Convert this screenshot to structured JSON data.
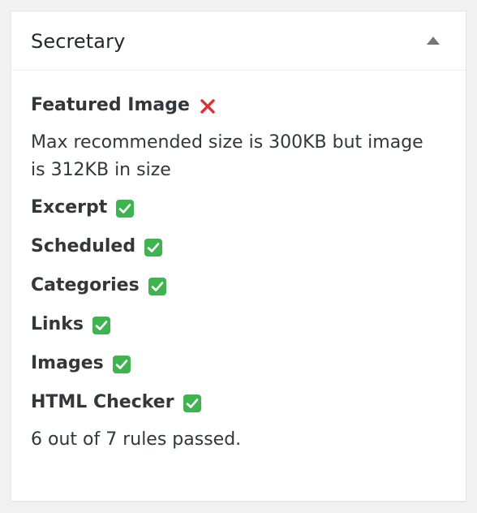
{
  "panel": {
    "title": "Secretary",
    "toggle_icon": "triangle-up-icon"
  },
  "rules": [
    {
      "name": "Featured Image",
      "status": "fail",
      "message": "Max recommended size is 300KB but image is 312KB in size"
    },
    {
      "name": "Excerpt",
      "status": "pass"
    },
    {
      "name": "Scheduled",
      "status": "pass"
    },
    {
      "name": "Categories",
      "status": "pass"
    },
    {
      "name": "Links",
      "status": "pass"
    },
    {
      "name": "Images",
      "status": "pass"
    },
    {
      "name": "HTML Checker",
      "status": "pass"
    }
  ],
  "summary": "6 out of 7 rules passed.",
  "colors": {
    "pass": "#3fb34f",
    "fail": "#dc3232"
  }
}
